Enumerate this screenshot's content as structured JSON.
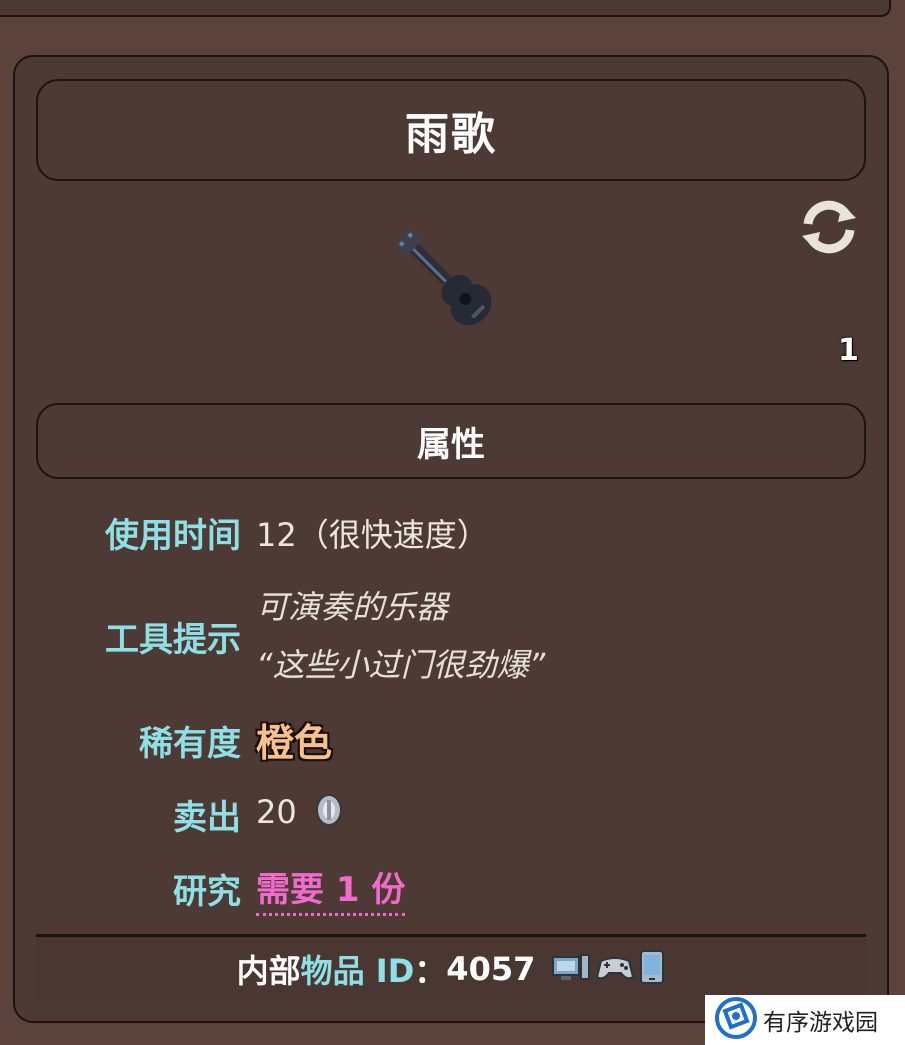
{
  "item": {
    "name": "雨歌",
    "stack_count": "1"
  },
  "section": {
    "attributes_title": "属性"
  },
  "stats": {
    "use_time_label": "使用时间",
    "use_time_value": "12（很快速度）",
    "tooltip_label": "工具提示",
    "tooltip_line1": "可演奏的乐器",
    "tooltip_line2": "“这些小过门很劲爆”",
    "rarity_label": "稀有度",
    "rarity_value": "橙色",
    "sell_label": "卖出",
    "sell_value": "20",
    "research_label": "研究",
    "research_value": "需要 1 份"
  },
  "footer": {
    "prefix": "内部",
    "item_word": "物品 ID",
    "colon": "：",
    "id_value": "4057"
  },
  "watermark": {
    "text": "有序游戏园"
  },
  "icons": [
    "refresh-icon",
    "guitar-item-icon",
    "silver-coin-icon",
    "desktop-icon",
    "console-icon",
    "mobile-icon",
    "watermark-logo-icon"
  ],
  "colors": {
    "background": "#5b433b",
    "panel": "#4e3a34",
    "label_cyan": "#8ee0e6",
    "rarity_orange": "#f6c18e",
    "research_pink": "#f06bcb"
  }
}
